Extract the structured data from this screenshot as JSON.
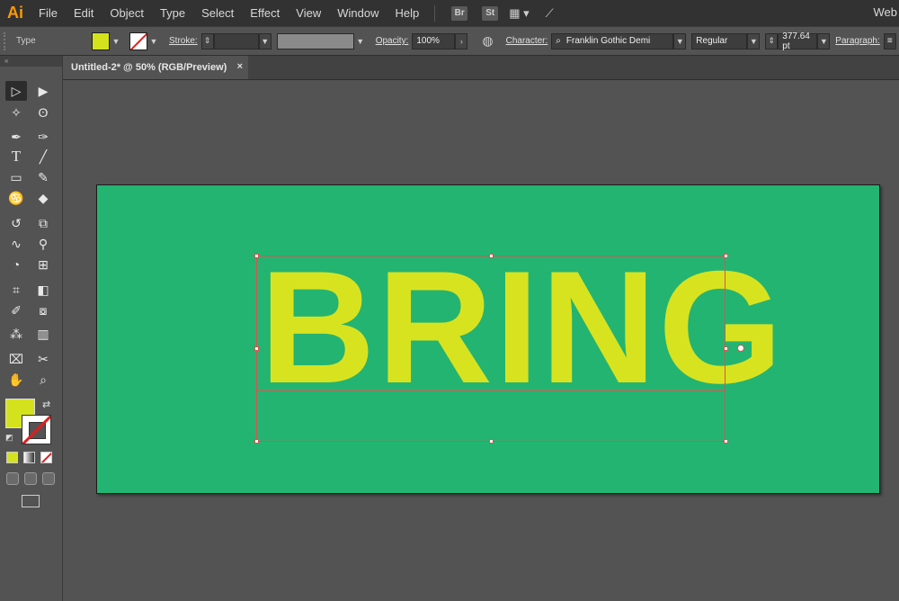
{
  "app": {
    "logo": "Ai"
  },
  "menu": {
    "items": [
      "File",
      "Edit",
      "Object",
      "Type",
      "Select",
      "Effect",
      "View",
      "Window",
      "Help"
    ],
    "bridge": "Br",
    "stock": "St",
    "workspace_right": "Web"
  },
  "control_bar": {
    "selection_type": "Type",
    "fill_color": "#d4e21e",
    "stroke_label": "Stroke:",
    "opacity_label": "Opacity:",
    "opacity_value": "100%",
    "character_label": "Character:",
    "font_family": "Franklin Gothic Demi",
    "font_style": "Regular",
    "font_size": "377.64 pt",
    "paragraph_label": "Paragraph:"
  },
  "document_tab": {
    "title": "Untitled-2* @ 50% (RGB/Preview)",
    "close": "×"
  },
  "artboard": {
    "background": "#24b471",
    "text": "BRING",
    "text_color": "#d8e31f"
  }
}
